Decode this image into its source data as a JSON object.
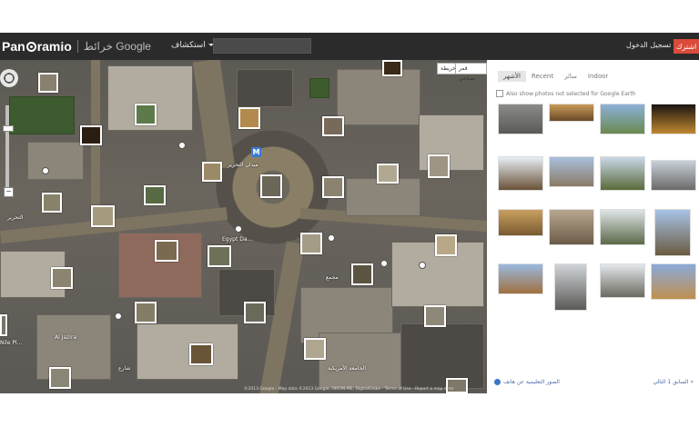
{
  "header": {
    "logo_text": "Pan",
    "logo_text_end": "ramio",
    "maps_label": "خرائط Google",
    "explore_label": "استكشاف",
    "search_value": "",
    "signin_label": "تسجيل الدخول",
    "join_label": "اشترك"
  },
  "map": {
    "type_map": "خريطة",
    "type_satellite": "قمر صناعي",
    "metro_label": "M",
    "labels": [
      "التحرير",
      "ميدان التحرير",
      "Egypt Da...",
      "Nile Pl...",
      "الجامعة الأمريكية",
      "مجمع",
      "شارع",
      "Al Jazira"
    ],
    "copyright": "©2013 Google - Map data ©2013 Google, ORION-ME, DigitalGlobe - Terms of Use - Report a map error"
  },
  "panel": {
    "tabs": [
      "الأشهر",
      "Recent",
      "سائر",
      "Indoor"
    ],
    "checkbox_label": "Also show photos not selected for Google Earth",
    "footer_left": "الصور التعليمية عن هاتف",
    "footer_right": "السابق  1  التالي »"
  },
  "colors": {
    "header_bg": "#2b2b2b",
    "join_button": "#d94b3a",
    "link": "#4a6aa8"
  }
}
